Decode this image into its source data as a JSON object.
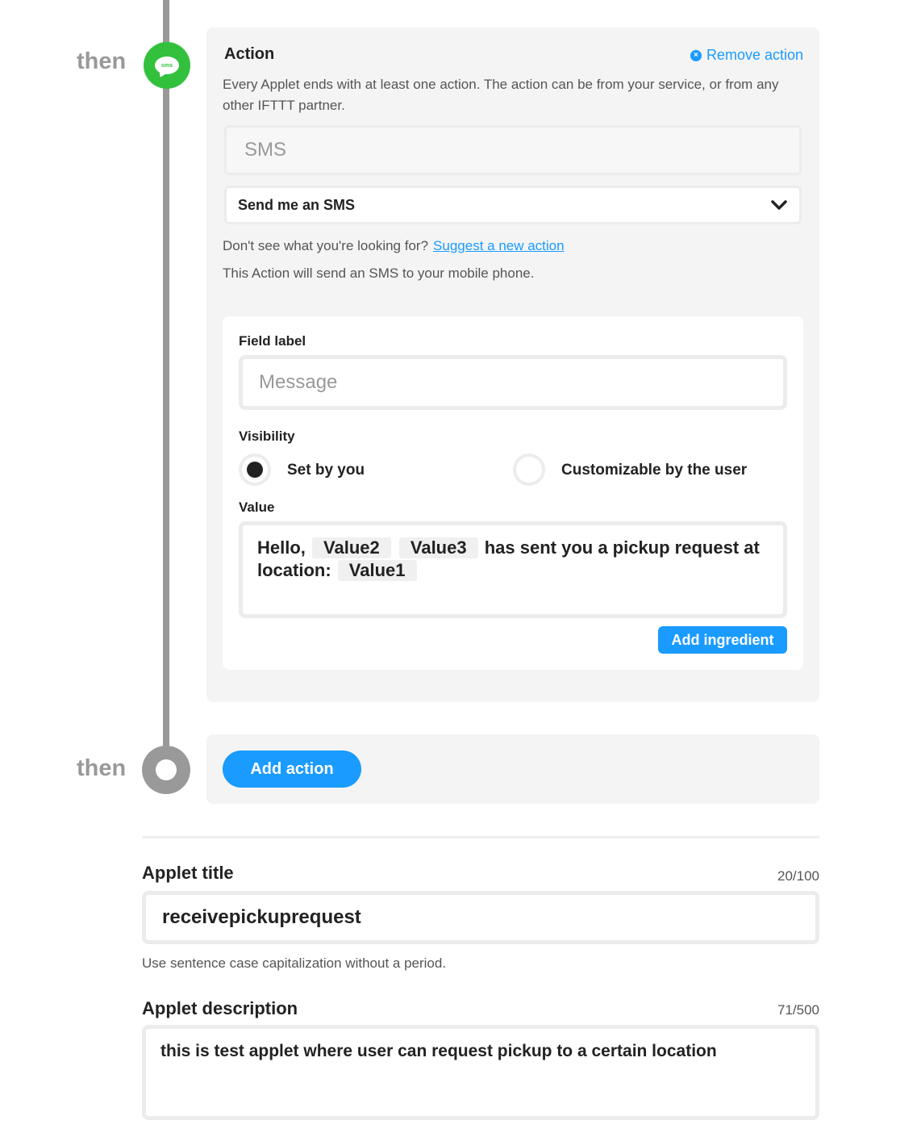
{
  "timeline": {
    "then_label_1": "then",
    "then_label_2": "then",
    "service_badge_text": "sms",
    "service_badge_color": "#33c13d"
  },
  "action": {
    "title": "Action",
    "remove_label": "Remove action",
    "description": "Every Applet ends with at least one action. The action can be from your service, or from any other IFTTT partner.",
    "service_value": "SMS",
    "selected_action": "Send me an SMS",
    "suggest_prompt": "Don't see what you're looking for?",
    "suggest_link": "Suggest a new action",
    "info_text": "This Action will send an SMS to your mobile phone."
  },
  "field": {
    "field_label_heading": "Field label",
    "field_label_value": "Message",
    "visibility_heading": "Visibility",
    "visibility_option_1": "Set by you",
    "visibility_option_2": "Customizable by the user",
    "visibility_selected": "Set by you",
    "value_heading": "Value",
    "value_text_1": "Hello,",
    "value_ingredient_1": "Value2",
    "value_ingredient_2": "Value3",
    "value_text_2": "has sent you a pickup request at location:",
    "value_ingredient_3": "Value1",
    "add_ingredient_label": "Add ingredient"
  },
  "add_action_label": "Add action",
  "applet": {
    "title_heading": "Applet title",
    "title_counter": "20/100",
    "title_value": "receivepickuprequest",
    "title_help": "Use sentence case capitalization without a period.",
    "description_heading": "Applet description",
    "description_counter": "71/500",
    "description_value": "this is test applet where user can request pickup to a certain location"
  },
  "colors": {
    "accent": "#1a9bff",
    "timeline": "#999999",
    "panel_bg": "#f4f4f4"
  }
}
